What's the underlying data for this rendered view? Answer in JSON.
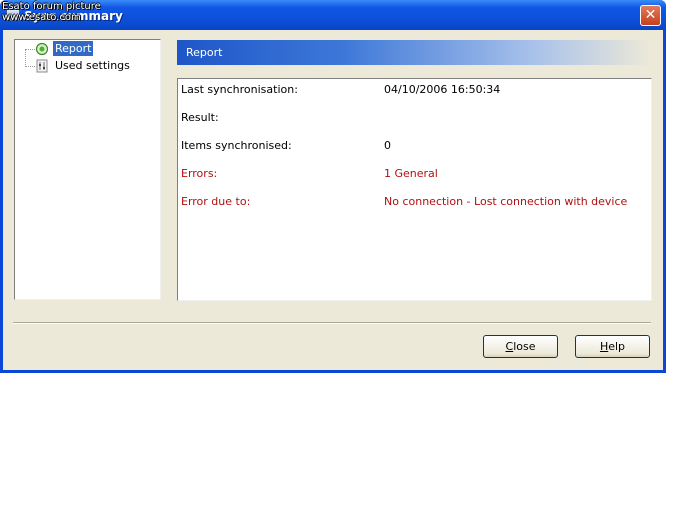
{
  "watermark": {
    "line1": "Esato forum picture",
    "line2": "www.esato.com"
  },
  "window": {
    "title": "Sync summary",
    "close_icon": "close-icon"
  },
  "tree": {
    "items": [
      {
        "label": "Report",
        "icon": "report-icon",
        "selected": true
      },
      {
        "label": "Used settings",
        "icon": "settings-icon",
        "selected": false
      }
    ]
  },
  "report": {
    "header": "Report",
    "rows": [
      {
        "label": "Last synchronisation:",
        "value": "04/10/2006 16:50:34",
        "color": "#000000"
      },
      {
        "label": "Result:",
        "value": "",
        "color": "#000000"
      },
      {
        "label": "Items synchronised:",
        "value": "0",
        "color": "#000000"
      },
      {
        "label": "Errors:",
        "value": "1 General",
        "color": "#b01010"
      },
      {
        "label": "Error due to:",
        "value": "No connection - Lost connection with device",
        "color": "#b01010"
      }
    ]
  },
  "buttons": {
    "close": {
      "acc": "C",
      "rest": "lose"
    },
    "help": {
      "acc": "H",
      "rest": "elp"
    }
  }
}
